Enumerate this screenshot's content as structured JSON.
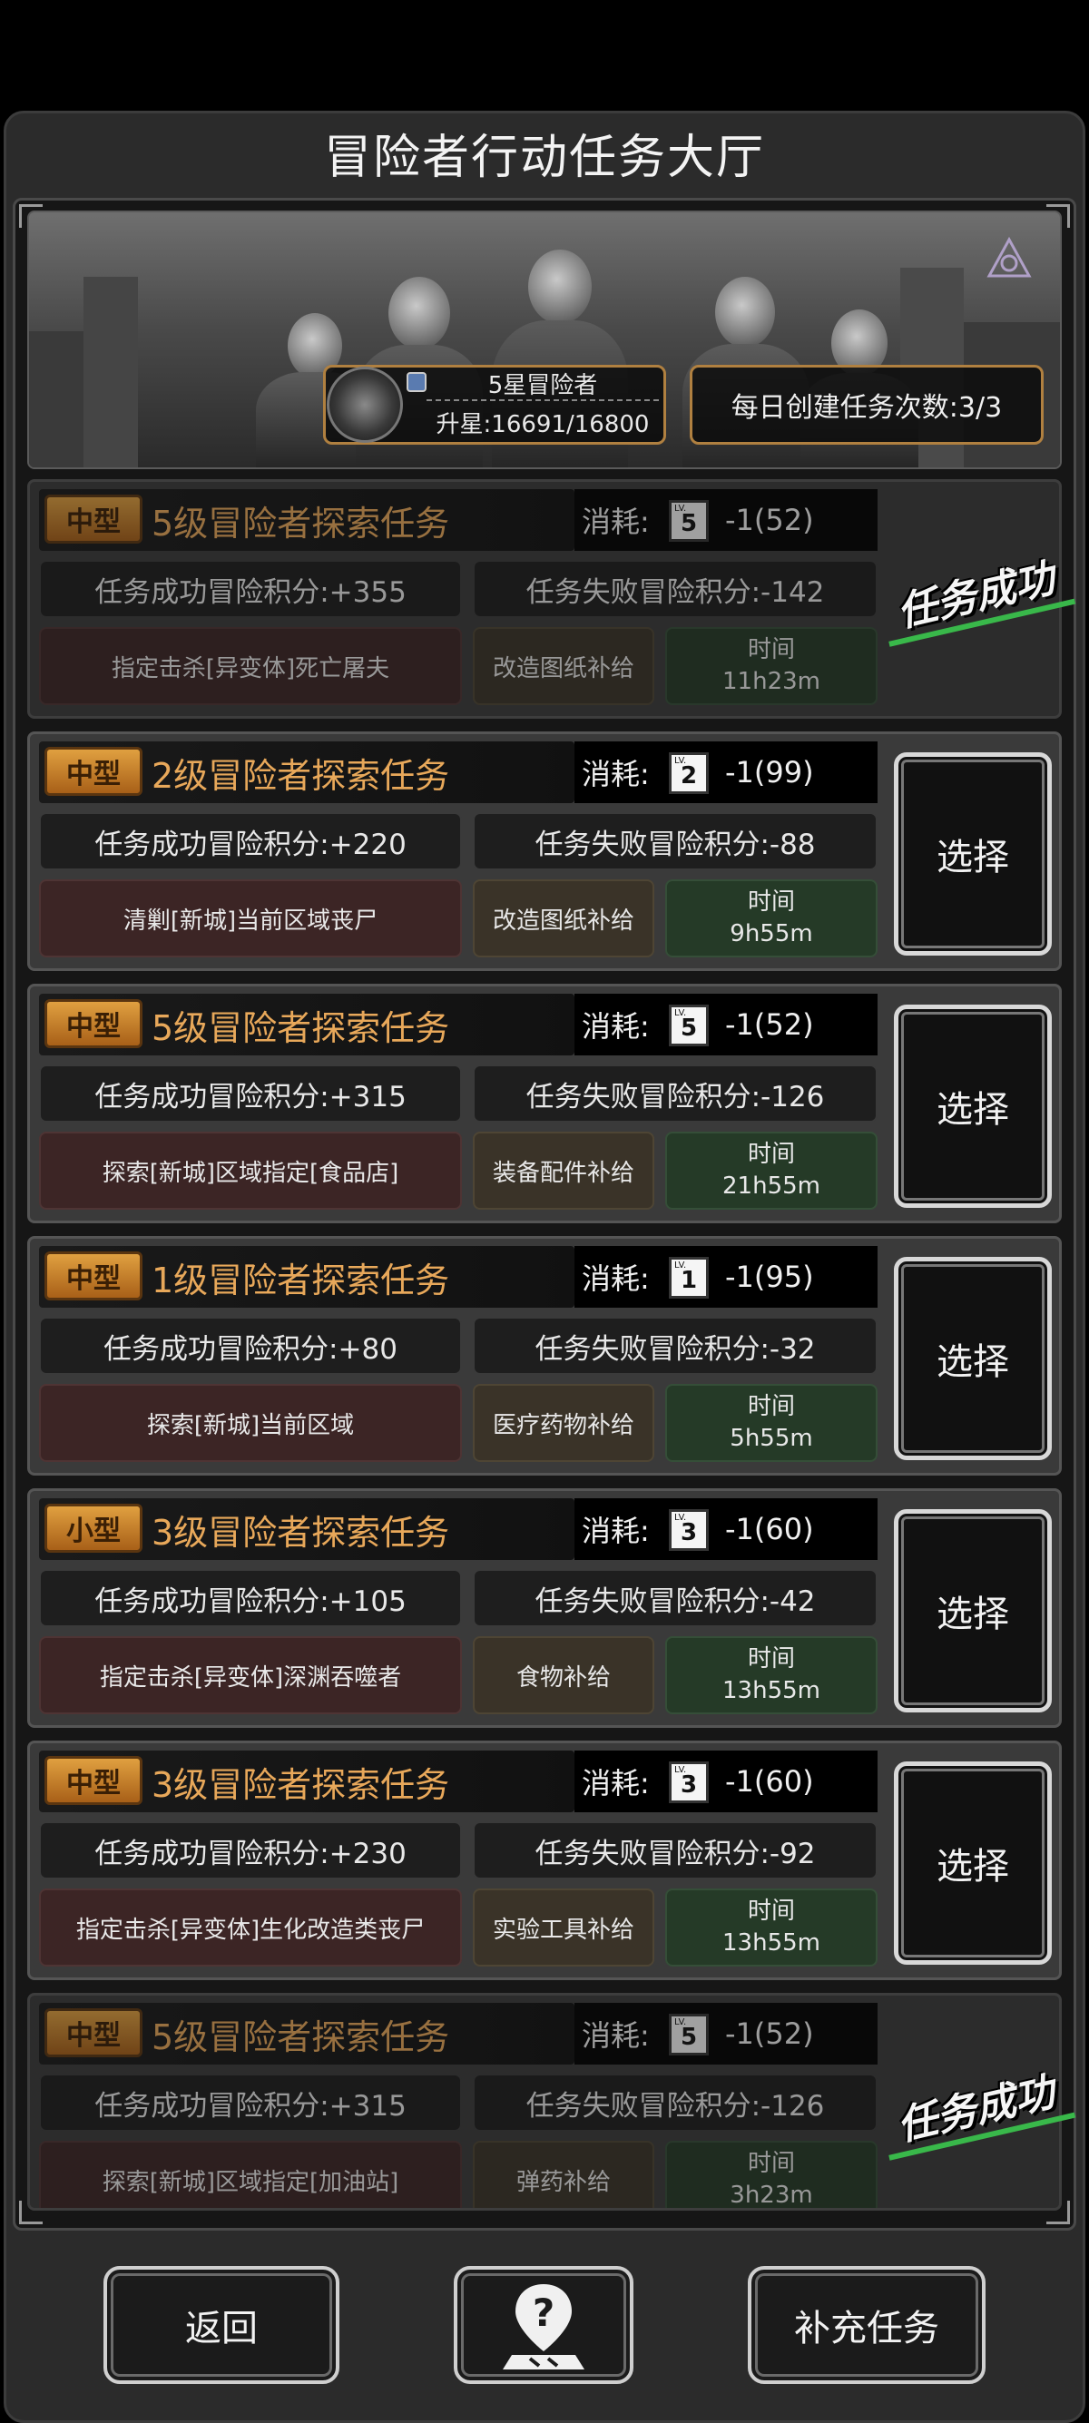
{
  "hall": {
    "title": "冒险者行动任务大厅",
    "rank": {
      "name": "5星冒险者",
      "progress": "升星:16691/16800"
    },
    "daily": "每日创建任务次数:3/3",
    "cost_label": "消耗:",
    "time_label": "时间",
    "select_label": "选择",
    "success_label": "任务成功"
  },
  "tasks": [
    {
      "size": "中型",
      "name": "5级冒险者探索任务",
      "level": "5",
      "cost": "-1(52)",
      "success": "任务成功冒险积分:+355",
      "fail": "任务失败冒险积分:-142",
      "objective": "指定击杀[异变体]死亡屠夫",
      "reward": "改造图纸补给",
      "time": "11h23m",
      "status": "completed"
    },
    {
      "size": "中型",
      "name": "2级冒险者探索任务",
      "level": "2",
      "cost": "-1(99)",
      "success": "任务成功冒险积分:+220",
      "fail": "任务失败冒险积分:-88",
      "objective": "清剿[新城]当前区域丧尸",
      "reward": "改造图纸补给",
      "time": "9h55m",
      "status": "available"
    },
    {
      "size": "中型",
      "name": "5级冒险者探索任务",
      "level": "5",
      "cost": "-1(52)",
      "success": "任务成功冒险积分:+315",
      "fail": "任务失败冒险积分:-126",
      "objective": "探索[新城]区域指定[食品店]",
      "reward": "装备配件补给",
      "time": "21h55m",
      "status": "available"
    },
    {
      "size": "中型",
      "name": "1级冒险者探索任务",
      "level": "1",
      "cost": "-1(95)",
      "success": "任务成功冒险积分:+80",
      "fail": "任务失败冒险积分:-32",
      "objective": "探索[新城]当前区域",
      "reward": "医疗药物补给",
      "time": "5h55m",
      "status": "available"
    },
    {
      "size": "小型",
      "name": "3级冒险者探索任务",
      "level": "3",
      "cost": "-1(60)",
      "success": "任务成功冒险积分:+105",
      "fail": "任务失败冒险积分:-42",
      "objective": "指定击杀[异变体]深渊吞噬者",
      "reward": "食物补给",
      "time": "13h55m",
      "status": "available"
    },
    {
      "size": "中型",
      "name": "3级冒险者探索任务",
      "level": "3",
      "cost": "-1(60)",
      "success": "任务成功冒险积分:+230",
      "fail": "任务失败冒险积分:-92",
      "objective": "指定击杀[异变体]生化改造类丧尸",
      "reward": "实验工具补给",
      "time": "13h55m",
      "status": "available"
    },
    {
      "size": "中型",
      "name": "5级冒险者探索任务",
      "level": "5",
      "cost": "-1(52)",
      "success": "任务成功冒险积分:+315",
      "fail": "任务失败冒险积分:-126",
      "objective": "探索[新城]区域指定[加油站]",
      "reward": "弹药补给",
      "time": "3h23m",
      "status": "completed"
    }
  ],
  "footer": {
    "back": "返回",
    "help_icon": "help-map-icon",
    "refill": "补充任务"
  },
  "colors": {
    "size_tag": "#d08a30",
    "task_name": "#e8a85a",
    "success_green": "#39b84a",
    "rank_border": "#b08040"
  }
}
